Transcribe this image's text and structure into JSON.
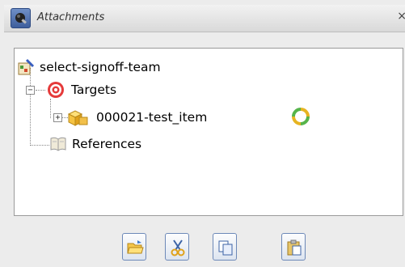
{
  "window": {
    "title": "Attachments",
    "close_glyph": "×"
  },
  "tree": {
    "root": {
      "label": "select-signoff-team",
      "icon": "process-icon"
    },
    "targets": {
      "label": "Targets",
      "icon": "target-icon",
      "expander": "−"
    },
    "item": {
      "label": "000021-test_item",
      "icon": "item-folder-icon",
      "expander": "+",
      "status_icon": "status-cycle-icon"
    },
    "references": {
      "label": "References",
      "icon": "book-icon"
    }
  },
  "toolbar": {
    "buttons": [
      {
        "icon": "folder-open-icon"
      },
      {
        "icon": "cut-icon"
      },
      {
        "icon": "copy-icon"
      },
      {
        "icon": "paste-icon"
      }
    ]
  }
}
